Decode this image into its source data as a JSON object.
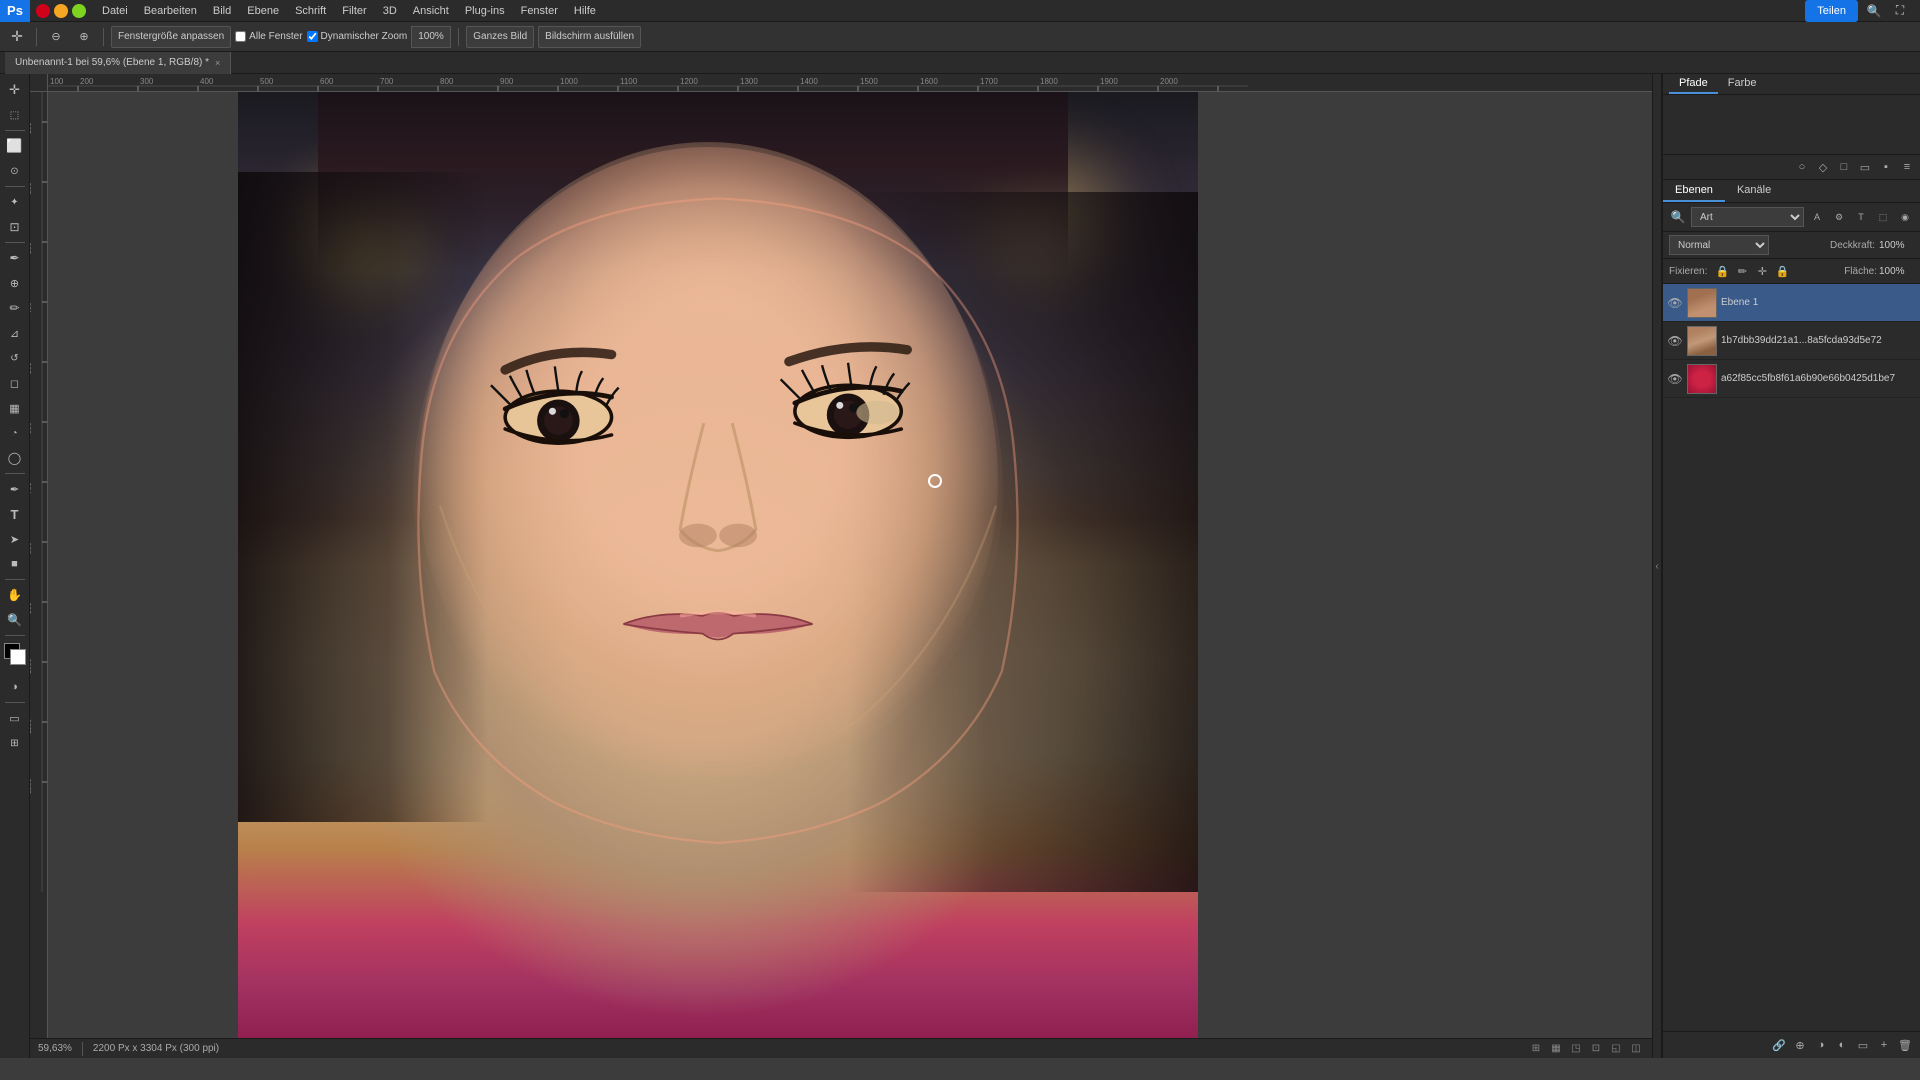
{
  "app": {
    "title": "Adobe Photoshop",
    "logo": "Ps"
  },
  "menubar": {
    "items": [
      "Datei",
      "Bearbeiten",
      "Bild",
      "Ebene",
      "Schrift",
      "Filter",
      "3D",
      "Ansicht",
      "Plug-ins",
      "Fenster",
      "Hilfe"
    ]
  },
  "toolbar": {
    "fit_window_label": "Fenstergröße anpassen",
    "all_windows_label": "Alle Fenster",
    "dynamic_zoom_label": "Dynamischer Zoom",
    "zoom_value": "100%",
    "fit_all_label": "Ganzes Bild",
    "fill_screen_label": "Bildschirm ausfüllen"
  },
  "document": {
    "tab_label": "Unbenannt-1 bei 59,6% (Ebene 1, RGB/8) *",
    "close": "×"
  },
  "canvas": {
    "width_info": "2200 Px x 3304 Px (300 ppi)",
    "zoom_info": "59,63%"
  },
  "paths_panel": {
    "tab_paths": "Pfade",
    "tab_color": "Farbe"
  },
  "layers_panel": {
    "tab_layers": "Ebenen",
    "tab_channels": "Kanäle",
    "filter_placeholder": "Art",
    "blend_mode": "Normal",
    "opacity_label": "Deckkraft:",
    "opacity_value": "100%",
    "fill_label": "Fläche:",
    "fill_value": "100%",
    "lock_label": "Fixieren:",
    "layers": [
      {
        "id": "layer1",
        "name": "Ebene 1",
        "visible": true,
        "active": true,
        "thumb_type": "face"
      },
      {
        "id": "layer2",
        "name": "1b7dbb39dd21a1...8a5fcda93d5e72",
        "visible": true,
        "active": false,
        "thumb_type": "face"
      },
      {
        "id": "layer3",
        "name": "a62f85cc5fb8f61a6b90e66b0425d1be7",
        "visible": true,
        "active": false,
        "thumb_type": "red"
      }
    ]
  },
  "statusbar": {
    "zoom": "59,63%",
    "doc_info": "2200 Px x 3304 Px (300 ppi)"
  },
  "icons": {
    "eye": "👁",
    "search": "🔍",
    "move": "✛",
    "zoom_in": "+",
    "share": "Teilen"
  }
}
